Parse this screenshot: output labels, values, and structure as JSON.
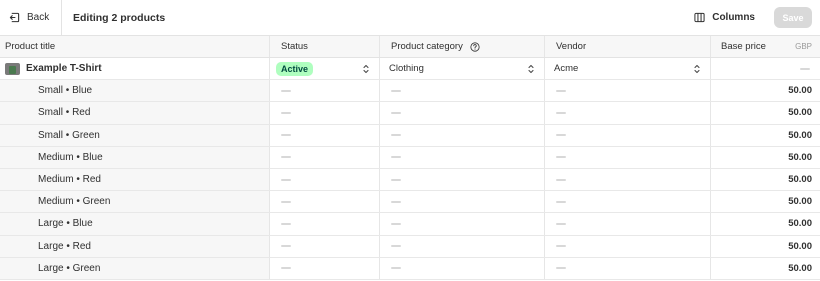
{
  "topbar": {
    "back_label": "Back",
    "title": "Editing 2 products",
    "columns_label": "Columns",
    "save_label": "Save"
  },
  "columns": {
    "title": "Product title",
    "status": "Status",
    "category": "Product category",
    "vendor": "Vendor",
    "price": "Base price",
    "currency": "GBP"
  },
  "product": {
    "title": "Example T-Shirt",
    "status": "Active",
    "category": "Clothing",
    "vendor": "Acme"
  },
  "variants": [
    {
      "title": "Small • Blue",
      "price": "50.00"
    },
    {
      "title": "Small • Red",
      "price": "50.00"
    },
    {
      "title": "Small • Green",
      "price": "50.00"
    },
    {
      "title": "Medium • Blue",
      "price": "50.00"
    },
    {
      "title": "Medium • Red",
      "price": "50.00"
    },
    {
      "title": "Medium • Green",
      "price": "50.00"
    },
    {
      "title": "Large • Blue",
      "price": "50.00"
    },
    {
      "title": "Large • Red",
      "price": "50.00"
    },
    {
      "title": "Large • Green",
      "price": "50.00"
    }
  ],
  "colors": {
    "badge_bg": "#affebf",
    "badge_text": "#014b40",
    "save_disabled": "#d9d9d9"
  }
}
